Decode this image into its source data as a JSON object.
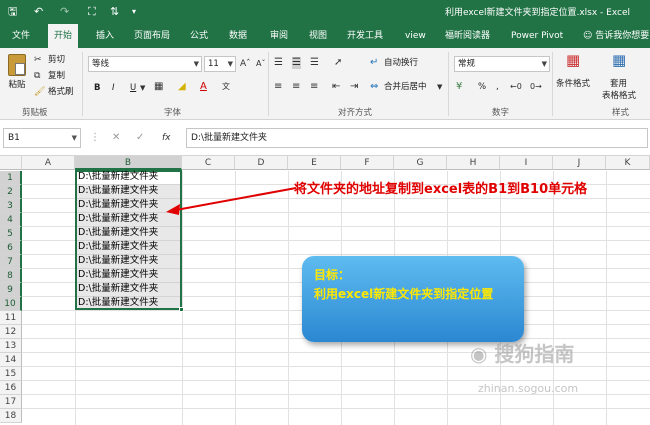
{
  "titlebar": {
    "title": "利用excel新建文件夹到指定位置.xlsx - Excel"
  },
  "tabs": [
    "文件",
    "开始",
    "插入",
    "页面布局",
    "公式",
    "数据",
    "审阅",
    "视图",
    "开发工具",
    "view",
    "福昕阅读器",
    "Power Pivot"
  ],
  "tell_me": "告诉我你想要",
  "ribbon": {
    "paste": "粘贴",
    "cut": "剪切",
    "copy": "复制",
    "format_painter": "格式刷",
    "clipboard_group": "剪贴板",
    "font_name": "等线",
    "font_size": "11",
    "font_group": "字体",
    "bold": "B",
    "italic": "I",
    "underline": "U",
    "wrap_text": "自动换行",
    "merge_center": "合并后居中",
    "alignment_group": "对齐方式",
    "number_format": "常规",
    "percent": "%",
    "comma": ",",
    "number_group": "数字",
    "conditional_format": "条件格式",
    "table_format_1": "套用",
    "table_format_2": "表格格式",
    "styles_group": "样式"
  },
  "formula_bar": {
    "name_box": "B1",
    "fx": "fx",
    "value": "D:\\批量新建文件夹"
  },
  "columns": [
    "A",
    "B",
    "C",
    "D",
    "E",
    "F",
    "G",
    "H",
    "I",
    "J",
    "K"
  ],
  "rows": [
    "1",
    "2",
    "3",
    "4",
    "5",
    "6",
    "7",
    "8",
    "9",
    "10",
    "11",
    "12",
    "13",
    "14",
    "15",
    "16",
    "17",
    "18"
  ],
  "cells_b": [
    "D:\\批量新建文件夹",
    "D:\\批量新建文件夹",
    "D:\\批量新建文件夹",
    "D:\\批量新建文件夹",
    "D:\\批量新建文件夹",
    "D:\\批量新建文件夹",
    "D:\\批量新建文件夹",
    "D:\\批量新建文件夹",
    "D:\\批量新建文件夹",
    "D:\\批量新建文件夹"
  ],
  "annotation": "将文件夹的地址复制到excel表的B1到B10单元格",
  "callout": {
    "title": "目标：",
    "body": "利用excel新建文件夹到指定位置"
  },
  "watermark": {
    "main": "搜狗指南",
    "sub": "zhinan.sogou.com"
  },
  "colors": {
    "excel_green": "#217346",
    "annotation_red": "#e00000",
    "callout_text": "#ffe800"
  }
}
